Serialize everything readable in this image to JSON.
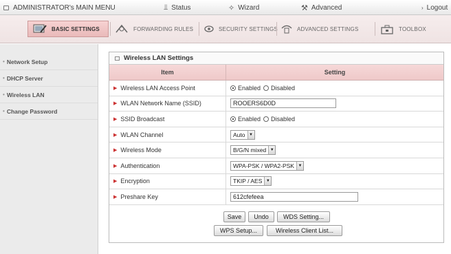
{
  "topbar": {
    "title": "ADMINISTRATOR's MAIN MENU",
    "status": "Status",
    "wizard": "Wizard",
    "advanced": "Advanced",
    "logout": "Logout"
  },
  "tabs": {
    "basic": "BASIC SETTINGS",
    "forwarding": "FORWARDING RULES",
    "security": "SECURITY SETTINGS",
    "advanced": "ADVANCED SETTINGS",
    "toolbox": "TOOLBOX"
  },
  "sidebar": {
    "items": [
      {
        "label": "Network Setup"
      },
      {
        "label": "DHCP Server"
      },
      {
        "label": "Wireless LAN"
      },
      {
        "label": "Change Password"
      }
    ]
  },
  "panel": {
    "title": "Wireless LAN Settings",
    "col_item": "Item",
    "col_setting": "Setting",
    "rows": {
      "ap_label": "Wireless LAN Access Point",
      "ap_enabled": "Enabled",
      "ap_disabled": "Disabled",
      "ssid_label": "WLAN Network Name (SSID)",
      "ssid_value": "ROOERS6D0D",
      "broadcast_label": "SSID Broadcast",
      "bc_enabled": "Enabled",
      "bc_disabled": "Disabled",
      "channel_label": "WLAN Channel",
      "channel_value": "Auto",
      "mode_label": "Wireless Mode",
      "mode_value": "B/G/N mixed",
      "auth_label": "Authentication",
      "auth_value": "WPA-PSK / WPA2-PSK",
      "enc_label": "Encryption",
      "enc_value": "TKIP / AES",
      "key_label": "Preshare Key",
      "key_value": "612cfefeea"
    },
    "buttons": {
      "save": "Save",
      "undo": "Undo",
      "wds": "WDS Setting...",
      "wps": "WPS Setup...",
      "clients": "Wireless Client List..."
    }
  },
  "colors": {
    "tab_active": "#e9b9b9",
    "header_pink": "#f6d8d8",
    "sidebar_bg": "#ebebeb",
    "arrow": "#cc3333"
  }
}
